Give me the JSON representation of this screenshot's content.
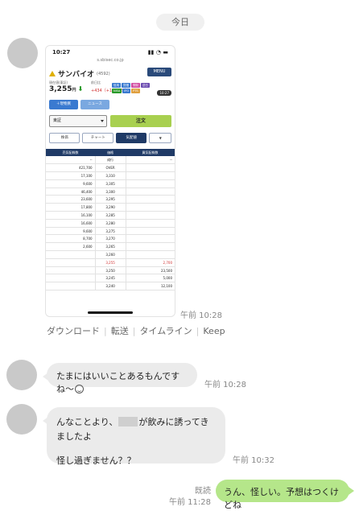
{
  "day_separator": "今日",
  "colors": {
    "received_bubble": "#ebebeb",
    "sent_bubble": "#b5e68a",
    "avatar": "#c9c9c9"
  },
  "screenshot": {
    "status_time": "10:27",
    "url": "s.sbisec.co.jp",
    "stock_name": "サンバイオ",
    "stock_code": "(4592)",
    "menu_label": "MENU",
    "price_label": "現在値(東証)",
    "price": "3,255",
    "price_unit": "円",
    "prev_label": "前日比",
    "change": "+434（+15.38%）",
    "time_badge": "10:27",
    "buy_button": "＋現物買",
    "sell_button": "ニュース",
    "market": "東証",
    "order_button": "注文",
    "tabs": [
      "株価",
      "チャート",
      "気配値",
      "▼"
    ],
    "board": {
      "headers": [
        "売気配株数",
        "価格",
        "買気配株数"
      ],
      "rows": [
        [
          "--",
          "成行",
          "--"
        ],
        [
          "421,700",
          "OVER",
          ""
        ],
        [
          "17,100",
          "3,310",
          ""
        ],
        [
          "9,600",
          "3,305",
          ""
        ],
        [
          "46,400",
          "3,300",
          ""
        ],
        [
          "23,600",
          "3,295",
          ""
        ],
        [
          "17,800",
          "3,290",
          ""
        ],
        [
          "16,100",
          "3,285",
          ""
        ],
        [
          "16,600",
          "3,280",
          ""
        ],
        [
          "9,600",
          "3,275",
          ""
        ],
        [
          "8,700",
          "3,270",
          ""
        ],
        [
          "2,600",
          "3,265",
          ""
        ],
        [
          "",
          "3,260",
          ""
        ],
        [
          "",
          "3,255",
          "2,700"
        ],
        [
          "",
          "3,250",
          "23,500"
        ],
        [
          "",
          "3,245",
          "5,000"
        ],
        [
          "",
          "3,240",
          "12,100"
        ]
      ]
    }
  },
  "screenshot_time": "午前 10:28",
  "message_actions": [
    "ダウンロード",
    "転送",
    "タイムライン",
    "Keep"
  ],
  "messages": [
    {
      "text": "たまにはいいことあるもんですね～",
      "time": "午前 10:28"
    },
    {
      "text_before": "んなことより、",
      "text_after": "が飲みに誘ってきましたよ",
      "text_line2": "怪し過ぎません？？",
      "time": "午前 10:32"
    }
  ],
  "sent": {
    "text": "うん、怪しい。予想はつくけどね",
    "read": "既読",
    "time": "午前 11:28"
  }
}
